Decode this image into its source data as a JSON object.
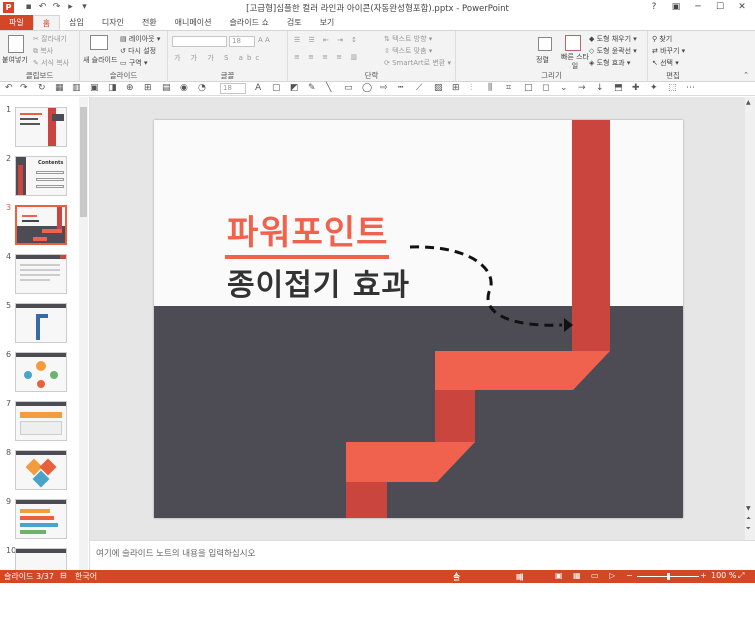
{
  "window": {
    "title": "[고급형]심플한 컬러 라인과 아이콘(자동완성형포함).pptx - PowerPoint",
    "controls": [
      "?",
      "▣",
      "─",
      "☐",
      "✕"
    ]
  },
  "tabs": [
    "파일",
    "홈",
    "삽입",
    "디자인",
    "전환",
    "애니메이션",
    "슬라이드 쇼",
    "검토",
    "보기"
  ],
  "ribbon": {
    "clipboard": {
      "label": "클립보드",
      "paste": "붙여넣기",
      "cut": "잘라내기",
      "copy": "복사",
      "format_painter": "서식 복사"
    },
    "slides": {
      "label": "슬라이드",
      "new_slide": "새 슬라이드",
      "layout": "레이아웃",
      "reset": "다시 설정",
      "section": "구역"
    },
    "font": {
      "label": "글꼴",
      "size": "18"
    },
    "paragraph": {
      "label": "단락",
      "text_direction": "텍스트 방향",
      "align_text": "텍스트 맞춤",
      "smartart": "SmartArt로 변환"
    },
    "drawing": {
      "label": "그리기",
      "arrange": "정렬",
      "quick_styles": "빠른 스타일",
      "fill": "도형 채우기",
      "outline": "도형 윤곽선",
      "effects": "도형 효과"
    },
    "editing": {
      "label": "편집",
      "find": "찾기",
      "replace": "바꾸기",
      "select": "선택"
    }
  },
  "toolbar2": {
    "font_size": "18"
  },
  "thumbnails": [
    {
      "num": "1"
    },
    {
      "num": "2",
      "caption": "Contents"
    },
    {
      "num": "3"
    },
    {
      "num": "4"
    },
    {
      "num": "5"
    },
    {
      "num": "6"
    },
    {
      "num": "7"
    },
    {
      "num": "8"
    },
    {
      "num": "9"
    },
    {
      "num": "10"
    }
  ],
  "slide": {
    "title": "파워포인트",
    "subtitle": "종이접기 효과",
    "colors": {
      "accent": "#f0624d",
      "dark_red": "#c9453d",
      "bottom_bg": "#4d4c55"
    }
  },
  "notes": {
    "placeholder": "여기에 슬라이드 노트의 내용을 입력하십시오"
  },
  "status": {
    "slide_info": "슬라이드 3/37",
    "language": "한국어",
    "notes_btn": "슬라이드 노트",
    "comments_btn": "메모",
    "zoom": "100 %"
  }
}
